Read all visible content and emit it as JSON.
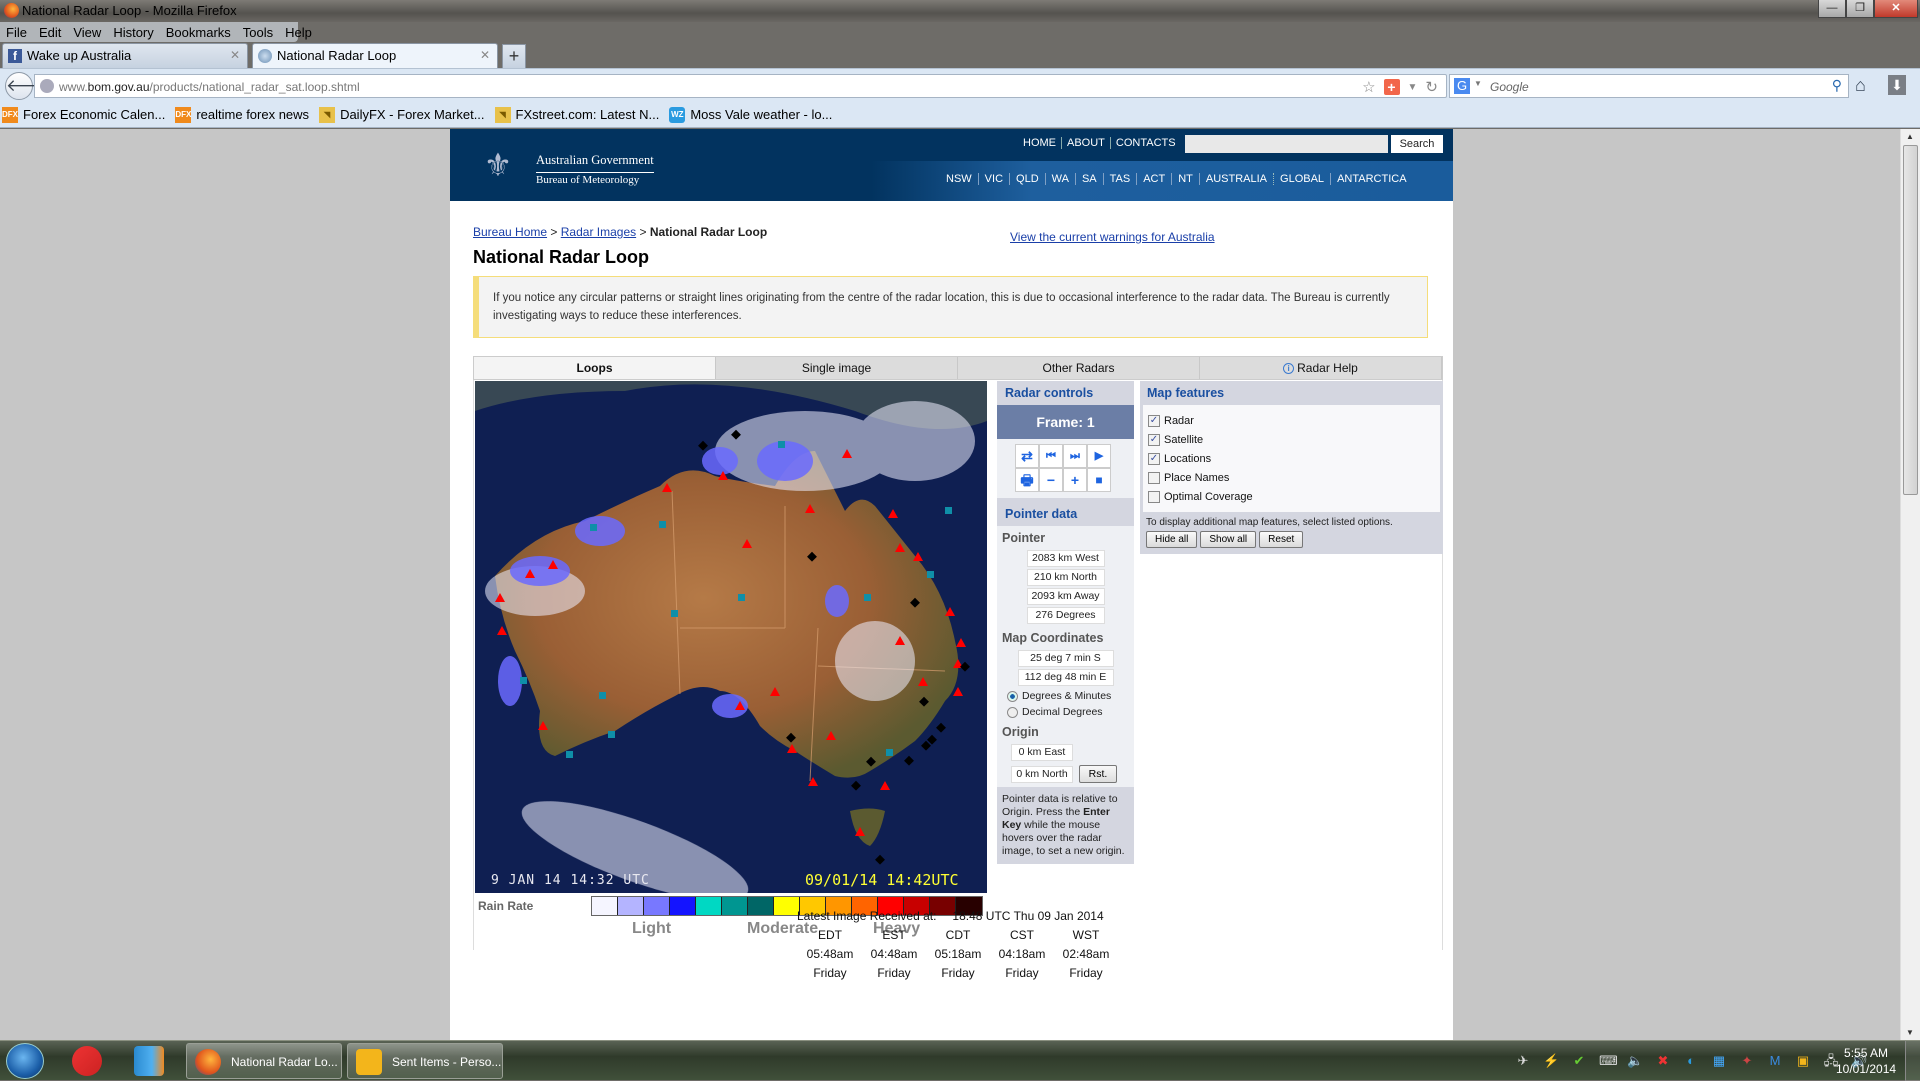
{
  "window": {
    "title": "National Radar Loop - Mozilla Firefox",
    "controls": [
      "minimize",
      "restore",
      "close"
    ]
  },
  "menu": [
    "File",
    "Edit",
    "View",
    "History",
    "Bookmarks",
    "Tools",
    "Help"
  ],
  "tabs": [
    {
      "label": "Wake up Australia",
      "icon": "facebook-icon",
      "active": false
    },
    {
      "label": "National Radar Loop",
      "icon": "globe-icon",
      "active": true
    }
  ],
  "url": {
    "prefix": "www.",
    "domain": "bom.gov.au",
    "path": "/products/national_radar_sat.loop.shtml"
  },
  "search_bar": {
    "placeholder": "Google",
    "engine": "G"
  },
  "bookmarks": [
    {
      "label": "Forex Economic Calen...",
      "icon": "DFX"
    },
    {
      "label": "realtime forex news",
      "icon": "DFX"
    },
    {
      "label": "DailyFX - Forex Market...",
      "icon": "rss"
    },
    {
      "label": "FXstreet.com: Latest N...",
      "icon": "rss"
    },
    {
      "label": "Moss Vale weather - lo...",
      "icon": "WZ"
    }
  ],
  "site_header": {
    "gov": "Australian Government",
    "agency": "Bureau of Meteorology",
    "top_links": [
      "HOME",
      "ABOUT",
      "CONTACTS"
    ],
    "search_button": "Search",
    "search_value": "",
    "state_links": [
      "NSW",
      "VIC",
      "QLD",
      "WA",
      "SA",
      "TAS",
      "ACT",
      "NT",
      "AUSTRALIA",
      "GLOBAL",
      "ANTARCTICA"
    ]
  },
  "breadcrumb": {
    "home": "Bureau Home",
    "sep": ">",
    "radar": "Radar Images",
    "current": "National Radar Loop"
  },
  "warnings_link": "View the current warnings for Australia",
  "page_title": "National Radar Loop",
  "notice": "If you notice any circular patterns or straight lines originating from the centre of the radar location, this is due to occasional interference to the radar data. The Bureau is currently investigating ways to reduce these interferences.",
  "content_tabs": [
    {
      "label": "Loops",
      "active": true
    },
    {
      "label": "Single image",
      "active": false
    },
    {
      "label": "Other Radars",
      "active": false
    },
    {
      "label": "Radar Help",
      "active": false,
      "icon": "info-icon"
    }
  ],
  "radar_image": {
    "satellite_stamp": "9 JAN 14 14:32 UTC",
    "radar_stamp": "09/01/14 14:42UTC"
  },
  "rain_rate": {
    "label": "Rain Rate",
    "colors": [
      "#f5f5ff",
      "#b4b4ff",
      "#7878ff",
      "#1414ff",
      "#00d8c3",
      "#009691",
      "#006666",
      "#ffff00",
      "#ffc800",
      "#ff9600",
      "#ff6400",
      "#ff0000",
      "#c80000",
      "#780000",
      "#280000"
    ],
    "labels": [
      "Light",
      "Moderate",
      "Heavy"
    ]
  },
  "radar_controls": {
    "title": "Radar controls",
    "frame_label": "Frame: 1",
    "buttons": [
      {
        "name": "toggle-direction",
        "glyph": "⇄"
      },
      {
        "name": "first-frame",
        "glyph": "⏮"
      },
      {
        "name": "next-frame",
        "glyph": "⏭"
      },
      {
        "name": "play",
        "glyph": "▶"
      },
      {
        "name": "print",
        "glyph": "🖶"
      },
      {
        "name": "slower",
        "glyph": "−"
      },
      {
        "name": "faster",
        "glyph": "+"
      },
      {
        "name": "stop",
        "glyph": "■"
      }
    ]
  },
  "pointer_data": {
    "title": "Pointer data",
    "pointer_label": "Pointer",
    "pointer": [
      "2083 km West",
      "210 km North",
      "2093 km Away",
      "276 Degrees"
    ],
    "coords_label": "Map Coordinates",
    "coords": [
      "25 deg 7 min S",
      "112 deg 48 min E"
    ],
    "format_options": [
      {
        "label": "Degrees & Minutes",
        "selected": true
      },
      {
        "label": "Decimal Degrees",
        "selected": false
      }
    ],
    "origin_label": "Origin",
    "origin": [
      "0 km East",
      "0 km North"
    ],
    "reset_button": "Rst.",
    "note_pre": "Pointer data is relative to Origin. Press the ",
    "note_key": "Enter Key",
    "note_post": " while the mouse hovers over the radar image, to set a new origin."
  },
  "map_features": {
    "title": "Map features",
    "items": [
      {
        "label": "Radar",
        "checked": true
      },
      {
        "label": "Satellite",
        "checked": true
      },
      {
        "label": "Locations",
        "checked": true
      },
      {
        "label": "Place Names",
        "checked": false
      },
      {
        "label": "Optimal Coverage",
        "checked": false
      }
    ],
    "tip": "To display additional map features, select listed options.",
    "buttons": [
      "Hide all",
      "Show all",
      "Reset"
    ]
  },
  "latest_image": {
    "label": "Latest Image Received at:",
    "value": "18:48 UTC Thu 09 Jan 2014",
    "zones": [
      {
        "tz": "EDT",
        "time": "05:48am",
        "day": "Friday"
      },
      {
        "tz": "EST",
        "time": "04:48am",
        "day": "Friday"
      },
      {
        "tz": "CDT",
        "time": "05:18am",
        "day": "Friday"
      },
      {
        "tz": "CST",
        "time": "04:18am",
        "day": "Friday"
      },
      {
        "tz": "WST",
        "time": "02:48am",
        "day": "Friday"
      }
    ]
  },
  "taskbar": {
    "buttons": [
      "National Radar Lo...",
      "Sent Items - Perso..."
    ],
    "clock_time": "5:55 AM",
    "clock_date": "10/01/2014"
  }
}
